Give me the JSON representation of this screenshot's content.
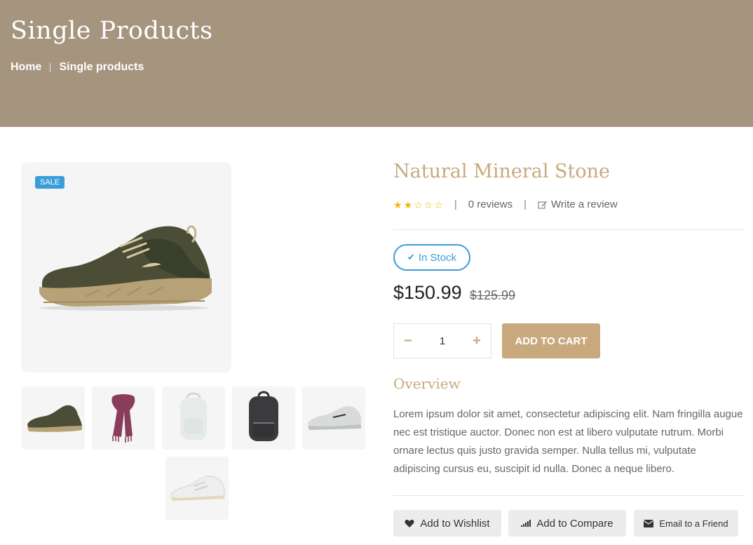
{
  "hero": {
    "title": "Single Products",
    "breadcrumb": [
      "Home",
      "Single products"
    ]
  },
  "gallery": {
    "badge": "SALE",
    "main_image": "olive-sneaker",
    "thumbnails": [
      "olive-sneaker",
      "pink-scarf",
      "white-backpack",
      "black-backpack",
      "grey-sneaker",
      "white-sneaker"
    ]
  },
  "product": {
    "title": "Natural Mineral Stone",
    "rating": 2,
    "rating_max": 5,
    "reviews": "0 reviews",
    "write_review": "Write a review",
    "stock": "In Stock",
    "price": "$150.99",
    "old_price": "$125.99",
    "quantity": "1",
    "add_to_cart": "ADD TO CART",
    "overview_title": "Overview",
    "overview_text": "Lorem ipsum dolor sit amet, consectetur adipiscing elit. Nam fringilla augue nec est tristique auctor. Donec non est at libero vulputate rutrum. Morbi ornare lectus quis justo gravida semper. Nulla tellus mi, vulputate adipiscing cursus eu, suscipit id nulla. Donec a neque libero."
  },
  "actions": {
    "wishlist": "Add to Wishlist",
    "compare": "Add to Compare",
    "email": "Email to a Friend"
  },
  "colors": {
    "hero_bg": "#a5957e",
    "accent": "#c8a97e",
    "badge_blue": "#3a9dd8",
    "star": "#f2b600"
  }
}
